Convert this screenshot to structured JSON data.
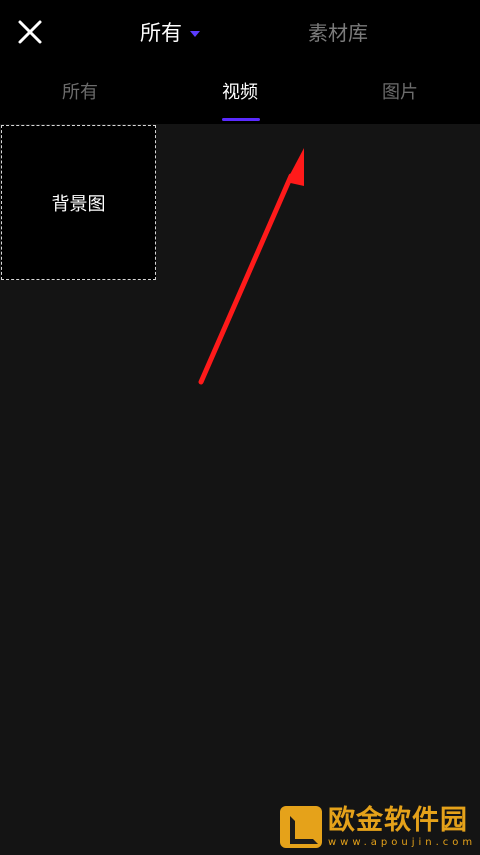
{
  "header": {
    "title": "所有",
    "library_label": "素材库"
  },
  "tabs": [
    {
      "label": "所有",
      "active": false
    },
    {
      "label": "视频",
      "active": true
    },
    {
      "label": "图片",
      "active": false
    }
  ],
  "grid": {
    "items": [
      {
        "label": "背景图"
      }
    ]
  },
  "colors": {
    "accent": "#5b2bff",
    "annotation_arrow": "#ff1a1a",
    "watermark": "#e5a21a"
  },
  "watermark": {
    "name": "欧金软件园",
    "url": "www.apoujin.com"
  },
  "icons": {
    "close": "close-icon",
    "dropdown": "chevron-down-icon",
    "arrow": "red-arrow-annotation"
  }
}
